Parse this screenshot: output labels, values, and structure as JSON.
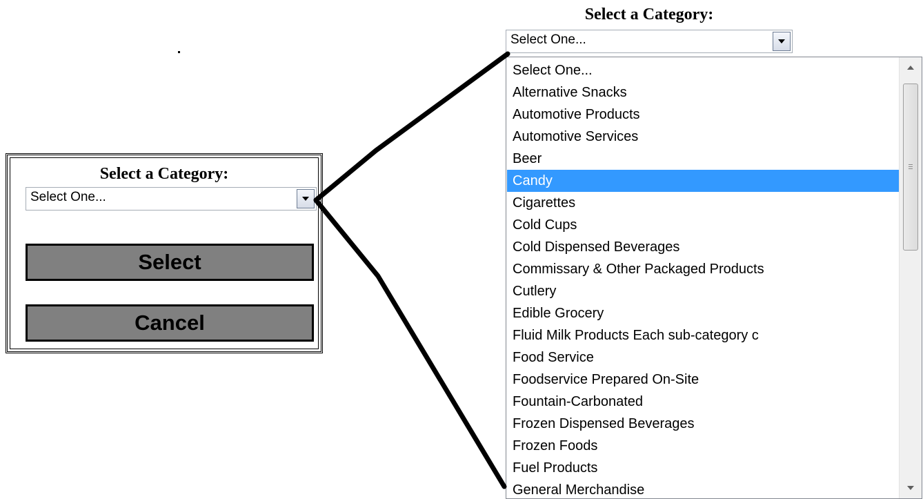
{
  "dialog": {
    "title": "Select a Category:",
    "select_value": "Select One...",
    "select_button": "Select",
    "cancel_button": "Cancel"
  },
  "expanded": {
    "title": "Select a Category:",
    "select_value": "Select One...",
    "selected_option": "Candy",
    "options": [
      "Select One...",
      "Alternative Snacks",
      "Automotive Products",
      "Automotive Services",
      "Beer",
      "Candy",
      "Cigarettes",
      "Cold Cups",
      "Cold Dispensed Beverages",
      "Commissary & Other Packaged Products",
      "Cutlery",
      "Edible Grocery",
      "Fluid Milk Products Each sub-category c",
      "Food Service",
      "Foodservice Prepared On-Site",
      "Fountain-Carbonated",
      "Frozen Dispensed Beverages",
      "Frozen Foods",
      "Fuel Products",
      "General Merchandise"
    ]
  },
  "icons": {
    "dropdown_arrow": "chevron-down-icon",
    "scroll_up": "scroll-up-icon",
    "scroll_down": "scroll-down-icon"
  },
  "colors": {
    "highlight": "#3399ff",
    "button_gray": "#808080"
  }
}
